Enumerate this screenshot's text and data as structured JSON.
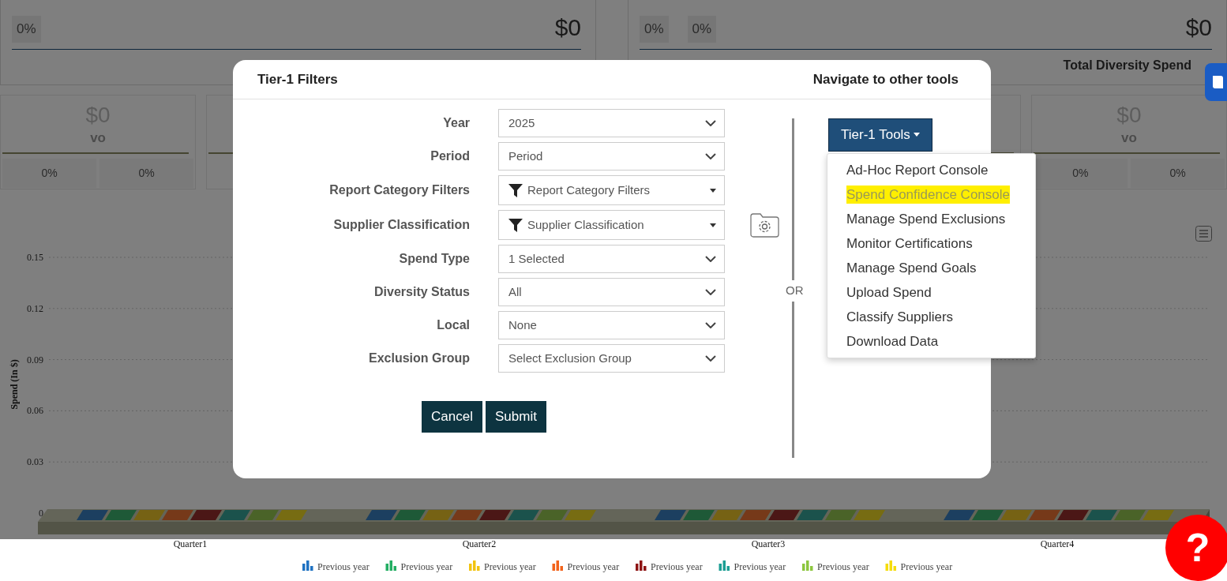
{
  "summary_panels": [
    {
      "percentages": [
        "0%"
      ],
      "amount": "$0"
    },
    {
      "percentages": [
        "0%",
        "0%"
      ],
      "amount": "$0",
      "title": "Total Diversity Spend"
    }
  ],
  "kpi_cards": [
    {
      "amount": "$0",
      "label": "vo",
      "percentages": [
        "0%",
        "0%"
      ]
    },
    {
      "amount": "$0",
      "label": "vo",
      "percentages": [
        "0%",
        "0%"
      ]
    }
  ],
  "chart": {
    "chart_data": {
      "type": "bar",
      "ylabel": "Spend (In $)",
      "categories": [
        "Quarter1",
        "Quarter2",
        "Quarter3",
        "Quarter4"
      ],
      "series": [
        {
          "name": "Previous year",
          "color": "#1f72c2",
          "values": [
            0,
            0,
            0,
            0
          ]
        },
        {
          "name": "Previous year",
          "color": "#23ae63",
          "values": [
            0,
            0,
            0,
            0
          ]
        },
        {
          "name": "Previous year",
          "color": "#f2c40f",
          "values": [
            0,
            0,
            0,
            0
          ]
        },
        {
          "name": "Previous year",
          "color": "#f2631b",
          "values": [
            0,
            0,
            0,
            0
          ]
        },
        {
          "name": "Previous year",
          "color": "#8e1414",
          "values": [
            0,
            0,
            0,
            0
          ]
        },
        {
          "name": "Previous year",
          "color": "#1c9e94",
          "values": [
            0,
            0,
            0,
            0
          ]
        },
        {
          "name": "Previous year",
          "color": "#8cc63e",
          "values": [
            0,
            0,
            0,
            0
          ]
        },
        {
          "name": "Previous year",
          "color": "#f5dc0a",
          "values": [
            0,
            0,
            0,
            0
          ]
        }
      ],
      "yticks": [
        0,
        0.03,
        0.06,
        0.09,
        0.12,
        0.15
      ],
      "ylim": [
        0,
        0.15
      ],
      "grid": true
    }
  },
  "modal": {
    "title": "Tier-1 Filters",
    "nav_title": "Navigate to other tools",
    "fields": [
      {
        "label": "Year",
        "kind": "select",
        "value": "2025"
      },
      {
        "label": "Period",
        "kind": "select",
        "value": "Period"
      },
      {
        "label": "Report Category Filters",
        "kind": "multiselect",
        "value": "Report Category Filters"
      },
      {
        "label": "Supplier Classification",
        "kind": "multiselect",
        "value": "Supplier Classification"
      },
      {
        "label": "Spend Type",
        "kind": "select",
        "value": "1 Selected"
      },
      {
        "label": "Diversity Status",
        "kind": "select",
        "value": "All"
      },
      {
        "label": "Local",
        "kind": "select",
        "value": "None"
      },
      {
        "label": "Exclusion Group",
        "kind": "select",
        "value": "Select Exclusion Group"
      }
    ],
    "buttons": [
      "Cancel",
      "Submit"
    ],
    "separator": "OR",
    "tools_button": {
      "label": "Tier-1 Tools",
      "expanded": true
    },
    "tools_menu": [
      {
        "label": "Ad-Hoc Report Console",
        "highlighted": false
      },
      {
        "label": "Spend Confidence Console",
        "highlighted": true
      },
      {
        "label": "Manage Spend Exclusions",
        "highlighted": false
      },
      {
        "label": "Monitor Certifications",
        "highlighted": false
      },
      {
        "label": "Manage Spend Goals",
        "highlighted": false
      },
      {
        "label": "Upload Spend",
        "highlighted": false
      },
      {
        "label": "Classify Suppliers",
        "highlighted": false
      },
      {
        "label": "Download Data",
        "highlighted": false
      }
    ]
  },
  "help_button": "?"
}
